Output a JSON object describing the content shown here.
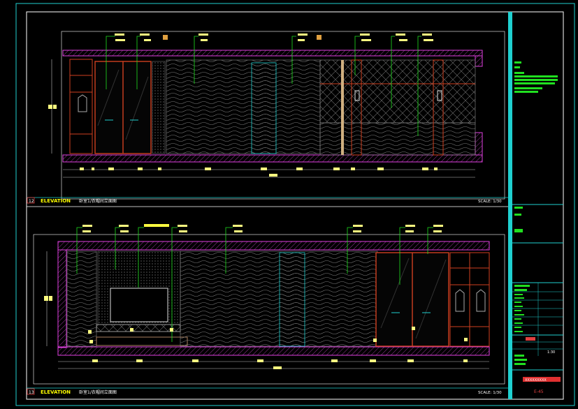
{
  "drawing": {
    "elevations": [
      {
        "number": "12",
        "title": "ELEVATION",
        "subtitle": "卧室1/衣帽间立面图",
        "scale": "SCALE: 1/30"
      },
      {
        "number": "13",
        "title": "ELEVATION",
        "subtitle": "卧室1/衣帽间立面图",
        "scale": "SCALE: 1/30"
      }
    ],
    "title_block": {
      "sheet_no": "E-45",
      "scale_value": "1:30",
      "project_stamp": "XXXXXXXXX"
    }
  },
  "colors": {
    "frame": "#1fd0d0",
    "wall": "#e040e0",
    "wood": "#d04020",
    "leader": "#20e020",
    "tag": "#ffff80",
    "texture": "#8a8a8a",
    "dim": "#c0c0c0"
  }
}
